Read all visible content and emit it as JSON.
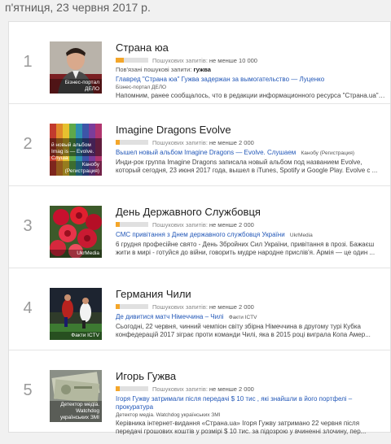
{
  "date_header": "п'ятниця, 23 червня 2017 р.",
  "volume_label": "Пошукових запитів:",
  "colors": {
    "accent_bar": "#f4a62a",
    "link": "#2358b8"
  },
  "items": [
    {
      "rank": "1",
      "title": "Страна юа",
      "volume": "не менше 10 000",
      "volume_level": 0.25,
      "related_label": "Пов'язані пошукові запити:",
      "related_value": "гужва",
      "thumb_caption": "Бізнес-портал ДЕЛО",
      "headline": "Главред \"Страна юа\" Гужва задержан за вымогательство — Луценко",
      "headline_source": "",
      "source": "Бізнес-портал ДЕЛО",
      "snippet": "Напомним, ранее сообщалось, что в редакции информационного ресурса \"Страна.ua\" ..."
    },
    {
      "rank": "2",
      "title": "Imagine Dragons Evolve",
      "volume": "не менше 2 000",
      "volume_level": 0.12,
      "thumb_caption": "Канобу (Регистрация)",
      "thumb_caption_top": "й новый альбом Imag is — Evolve. Слуша",
      "headline": "Вышел новый альбом Imagine Dragons — Evolve. Слушаем",
      "headline_source": "Канобу (Регистрация)",
      "snippet": "Инди-рок группа Imagine Dragons записала новый альбом под названием Evolve, который сегодня, 23 июня 2017 года, вышел в iTunes, Spotify и Google Play. Evolve с ..."
    },
    {
      "rank": "3",
      "title": "День Державного Службовця",
      "volume": "не менше 2 000",
      "volume_level": 0.12,
      "thumb_caption": "UkrMedia",
      "headline": "СМС привітання з Днем державного службовця України",
      "headline_source": "UkrMedia",
      "snippet": "6 грудня професійне свято - День Збройних Сил України, привітання в прозі. Бажаєш жити в мирі - готуйся до війни, говорить мудре народне прислів'я. Армія — це один ..."
    },
    {
      "rank": "4",
      "title": "Германия Чили",
      "volume": "не менше 2 000",
      "volume_level": 0.12,
      "thumb_caption": "Факти ICTV",
      "headline": "Де дивитися матч Німеччина – Чилі",
      "headline_source": "Факти ICTV",
      "snippet": "Сьогодні, 22 червня, чинний чемпіон світу збірна Німеччина в другому турі Кубка конфедерацій 2017 зіграє проти команди Чилі, яка в 2015 році виграла Копа Амер..."
    },
    {
      "rank": "5",
      "title": "Игорь Гужва",
      "volume": "не менше 2 000",
      "volume_level": 0.12,
      "thumb_caption": "Детектор медіа. Watchdog українських ЗМІ",
      "headline": "Ігоря Гужву затримали після передачі $ 10 тис , які знайшли в його портфелі – прокуратура",
      "headline_source": "",
      "source": "Детектор медіа. Watchdog українських ЗМІ",
      "snippet": "Керівника інтернет-видання «Страна.ua» Ігоря Гужву затримано 22 червня після передачі грошових коштів у розмірі $ 10 тис. за підозрою у вчиненні злочину, пер..."
    }
  ]
}
